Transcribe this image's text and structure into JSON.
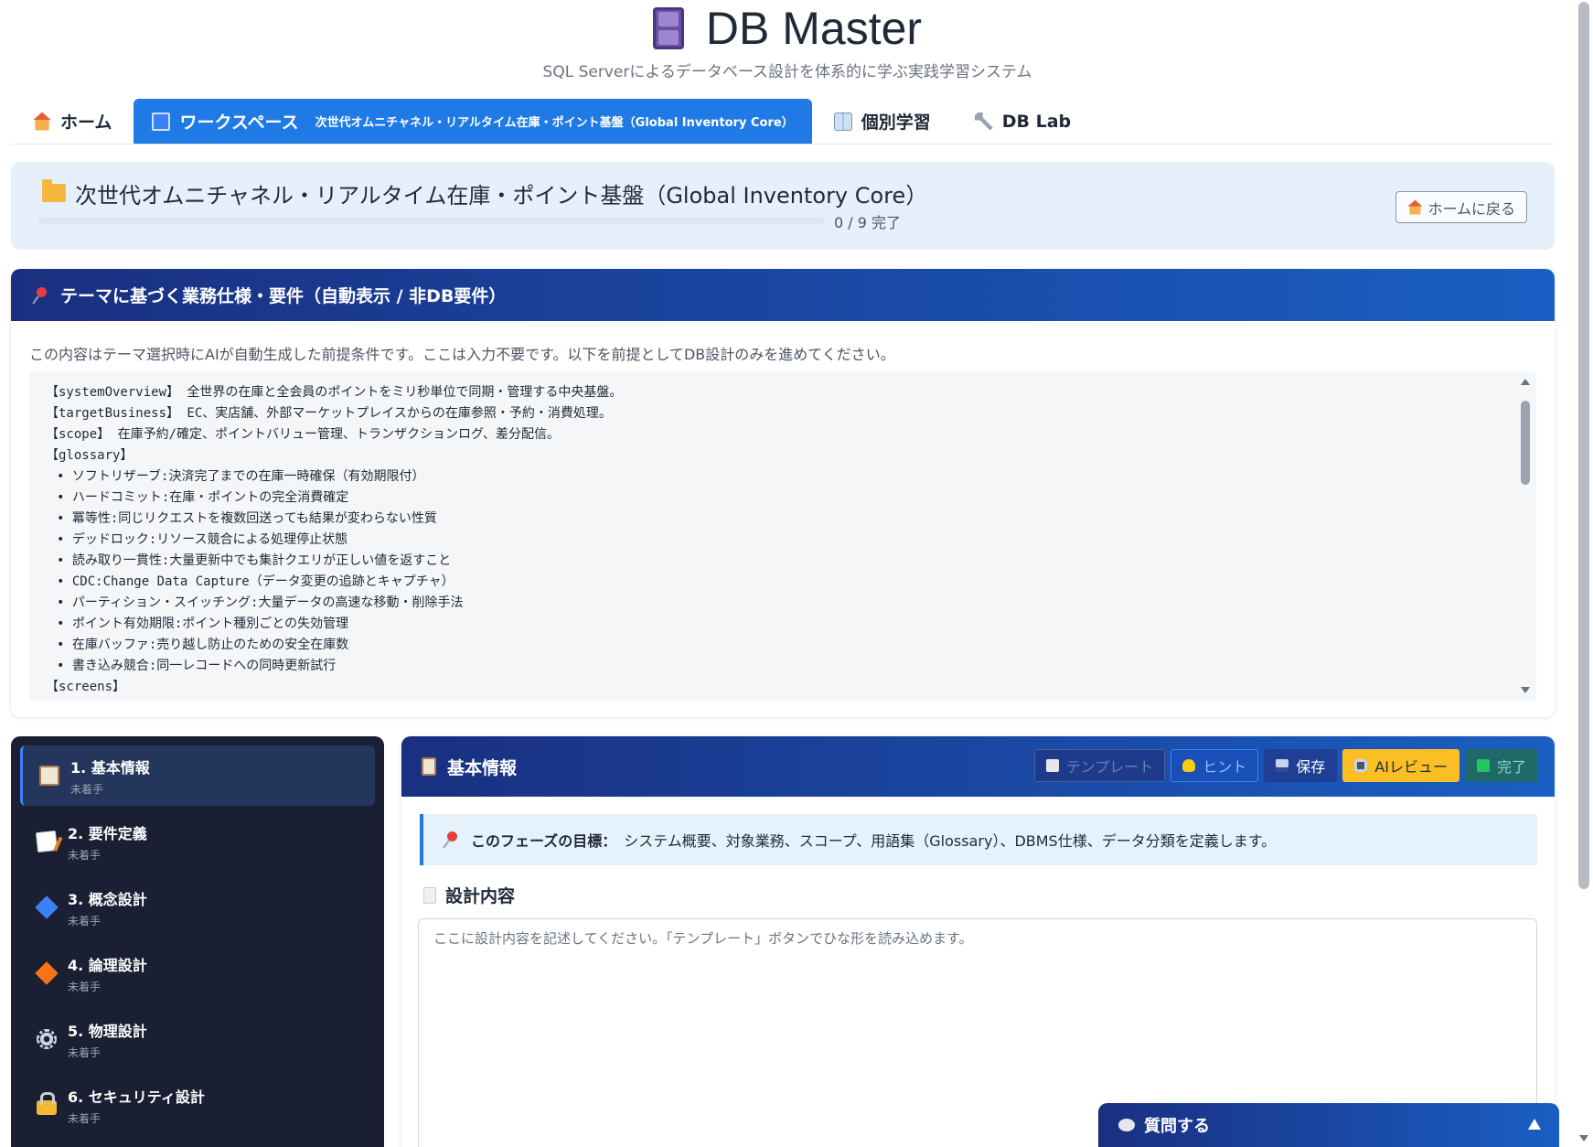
{
  "app": {
    "title": "DB Master",
    "subtitle": "SQL Serverによるデータベース設計を体系的に学ぶ実践学習システム",
    "logo_icon": "file-cabinet-icon"
  },
  "tabs": [
    {
      "label": "ホーム",
      "icon": "house-icon",
      "active": false
    },
    {
      "label": "ワークスペース",
      "sub": "次世代オムニチャネル・リアルタイム在庫・ポイント基盤（Global Inventory Core）",
      "icon": "laptop-icon",
      "active": true
    },
    {
      "label": "個別学習",
      "icon": "book-icon",
      "active": false
    },
    {
      "label": "DB Lab",
      "icon": "wrench-icon",
      "active": false
    }
  ],
  "project": {
    "title": "次世代オムニチャネル・リアルタイム在庫・ポイント基盤（Global Inventory Core）",
    "progress_text": "0 / 9 完了",
    "progress_fraction": 0,
    "home_button": "ホームに戻る"
  },
  "requirements": {
    "header": "テーマに基づく業務仕様・要件（自動表示 / 非DB要件）",
    "description": "この内容はテーマ選択時にAIが自動生成した前提条件です。ここは入力不要です。以下を前提としてDB設計のみを進めてください。",
    "lines": [
      "【systemOverview】 全世界の在庫と全会員のポイントをミリ秒単位で同期・管理する中央基盤。",
      "【targetBusiness】 EC、実店舗、外部マーケットプレイスからの在庫参照・予約・消費処理。",
      "【scope】 在庫予約/確定、ポイントバリュー管理、トランザクションログ、差分配信。",
      "【glossary】",
      "• ソフトリザーブ:決済完了までの在庫一時確保（有効期限付）",
      "• ハードコミット:在庫・ポイントの完全消費確定",
      "• 冪等性:同じリクエストを複数回送っても結果が変わらない性質",
      "• デッドロック:リソース競合による処理停止状態",
      "• 読み取り一貫性:大量更新中でも集計クエリが正しい値を返すこと",
      "• CDC:Change Data Capture（データ変更の追跡とキャプチャ）",
      "• パーティション・スイッチング:大量データの高速な移動・削除手法",
      "• ポイント有効期限:ポイント種別ごとの失効管理",
      "• 在庫バッファ:売り越し防止のための安全在庫数",
      "• 書き込み競合:同一レコードへの同時更新試行",
      "【screens】"
    ]
  },
  "phases": [
    {
      "label": "1. 基本情報",
      "status": "未着手",
      "icon": "clipboard-icon",
      "active": true
    },
    {
      "label": "2. 要件定義",
      "status": "未着手",
      "icon": "memo-icon",
      "active": false
    },
    {
      "label": "3. 概念設計",
      "status": "未着手",
      "icon": "blue-diamond-icon",
      "active": false
    },
    {
      "label": "4. 論理設計",
      "status": "未着手",
      "icon": "orange-diamond-icon",
      "active": false
    },
    {
      "label": "5. 物理設計",
      "status": "未着手",
      "icon": "gear-icon",
      "active": false
    },
    {
      "label": "6. セキュリティ設計",
      "status": "未着手",
      "icon": "lock-icon",
      "active": false
    }
  ],
  "editor": {
    "title": "基本情報",
    "toolbar": {
      "template": "テンプレート",
      "hint": "ヒント",
      "save": "保存",
      "ai_review": "AIレビュー",
      "done": "完了"
    },
    "goal_label": "このフェーズの目標：",
    "goal_text": "システム概要、対象業務、スコープ、用語集（Glossary）、DBMS仕様、データ分類を定義します。",
    "design_label": "設計内容",
    "textarea_value": "",
    "textarea_placeholder": "ここに設計内容を記述してください。「テンプレート」ボタンでひな形を読み込めます。"
  },
  "ask": {
    "label": "質問する"
  },
  "colors": {
    "primary": "#1f7ae6",
    "header_gradient_start": "#1a2f80",
    "header_gradient_end": "#1a5fc4",
    "sidebar_bg": "#1b1f33",
    "review_button": "#fbbf24"
  }
}
